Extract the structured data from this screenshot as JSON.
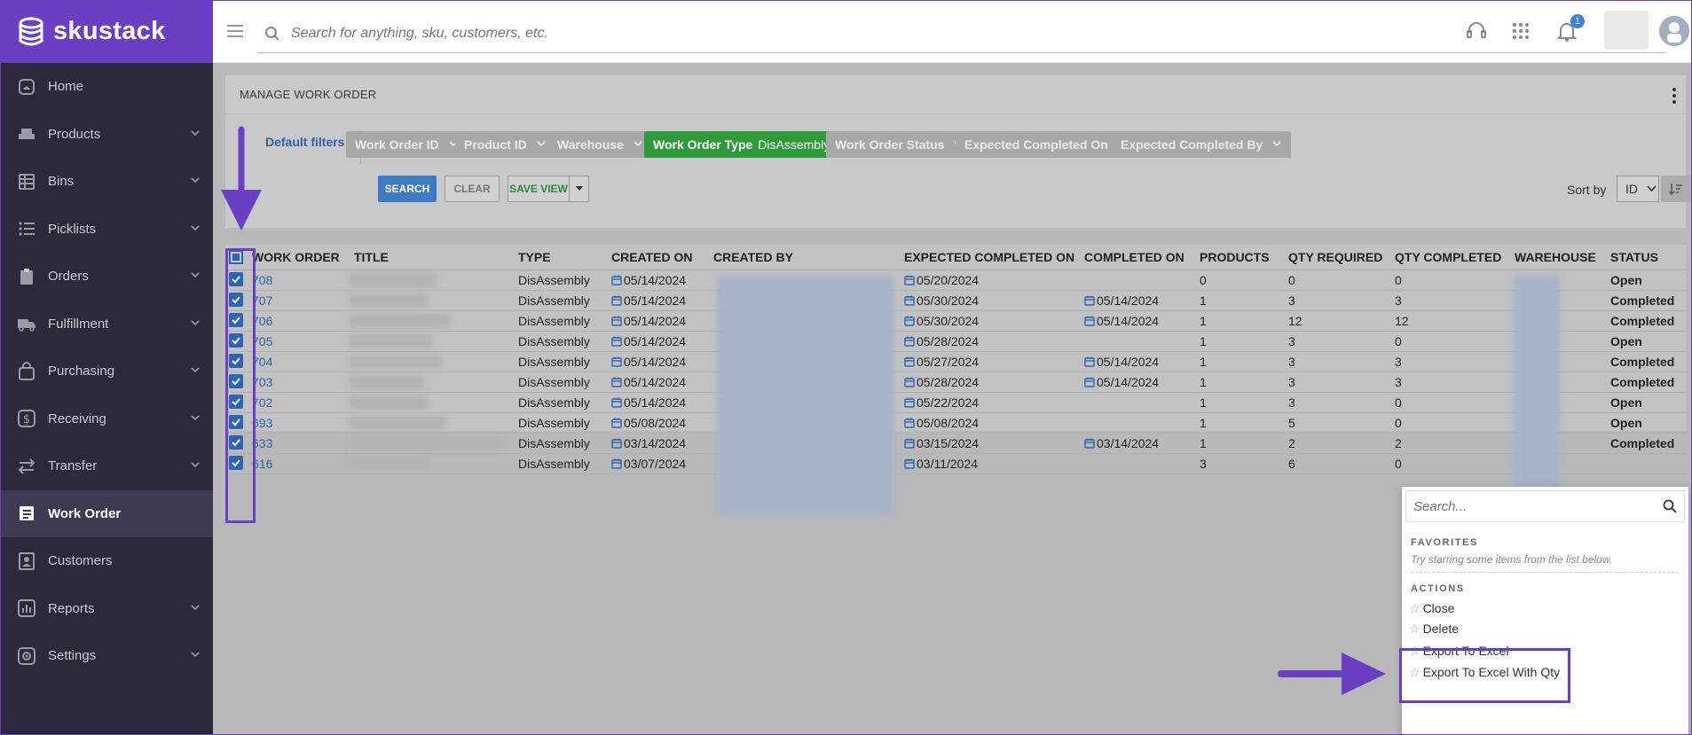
{
  "brand": {
    "name": "skustack"
  },
  "search": {
    "placeholder": "Search for anything, sku, customers, etc."
  },
  "header": {
    "notification_count": "1"
  },
  "sidebar": {
    "items": [
      {
        "label": "Home",
        "icon": "home-icon",
        "chevron": false
      },
      {
        "label": "Products",
        "icon": "products-icon",
        "chevron": true
      },
      {
        "label": "Bins",
        "icon": "bins-icon",
        "chevron": true
      },
      {
        "label": "Picklists",
        "icon": "picklists-icon",
        "chevron": true
      },
      {
        "label": "Orders",
        "icon": "orders-icon",
        "chevron": true
      },
      {
        "label": "Fulfillment",
        "icon": "truck-icon",
        "chevron": true
      },
      {
        "label": "Purchasing",
        "icon": "bag-icon",
        "chevron": true
      },
      {
        "label": "Receiving",
        "icon": "dollar-icon",
        "chevron": true
      },
      {
        "label": "Transfer",
        "icon": "transfer-icon",
        "chevron": true
      },
      {
        "label": "Work Order",
        "icon": "work-order-icon",
        "chevron": false,
        "active": true
      },
      {
        "label": "Customers",
        "icon": "customers-icon",
        "chevron": false
      },
      {
        "label": "Reports",
        "icon": "reports-icon",
        "chevron": true
      },
      {
        "label": "Settings",
        "icon": "gear-icon",
        "chevron": true
      }
    ]
  },
  "page": {
    "title": "MANAGE WORK ORDER",
    "default_filters": "Default filters",
    "filters": [
      {
        "label": "Work Order ID",
        "value": ""
      },
      {
        "label": "Product ID",
        "value": ""
      },
      {
        "label": "Warehouse",
        "value": ""
      },
      {
        "label": "Work Order Type",
        "value": "DisAssembly",
        "active": true
      },
      {
        "label": "Work Order Status",
        "value": ""
      },
      {
        "label": "Expected Completed On",
        "value": ""
      },
      {
        "label": "Expected Completed By",
        "value": ""
      }
    ],
    "buttons": {
      "search": "SEARCH",
      "clear": "CLEAR",
      "save_view": "SAVE VIEW"
    },
    "sort": {
      "label": "Sort by",
      "value": "ID"
    }
  },
  "table": {
    "columns": [
      "WORK ORDER",
      "TITLE",
      "TYPE",
      "CREATED ON",
      "CREATED BY",
      "EXPECTED COMPLETED ON",
      "COMPLETED ON",
      "PRODUCTS",
      "QTY REQUIRED",
      "QTY COMPLETED",
      "WAREHOUSE",
      "STATUS"
    ],
    "rows": [
      {
        "id": "708",
        "type": "DisAssembly",
        "created_on": "05/14/2024",
        "expected": "05/20/2024",
        "completed": "",
        "products": "0",
        "qty_required": "0",
        "qty_completed": "0",
        "status": "Open"
      },
      {
        "id": "707",
        "type": "DisAssembly",
        "created_on": "05/14/2024",
        "expected": "05/30/2024",
        "completed": "05/14/2024",
        "products": "1",
        "qty_required": "3",
        "qty_completed": "3",
        "status": "Completed"
      },
      {
        "id": "706",
        "type": "DisAssembly",
        "created_on": "05/14/2024",
        "expected": "05/30/2024",
        "completed": "05/14/2024",
        "products": "1",
        "qty_required": "12",
        "qty_completed": "12",
        "status": "Completed"
      },
      {
        "id": "705",
        "type": "DisAssembly",
        "created_on": "05/14/2024",
        "expected": "05/28/2024",
        "completed": "",
        "products": "1",
        "qty_required": "3",
        "qty_completed": "0",
        "status": "Open"
      },
      {
        "id": "704",
        "type": "DisAssembly",
        "created_on": "05/14/2024",
        "expected": "05/27/2024",
        "completed": "05/14/2024",
        "products": "1",
        "qty_required": "3",
        "qty_completed": "3",
        "status": "Completed"
      },
      {
        "id": "703",
        "type": "DisAssembly",
        "created_on": "05/14/2024",
        "expected": "05/28/2024",
        "completed": "05/14/2024",
        "products": "1",
        "qty_required": "3",
        "qty_completed": "3",
        "status": "Completed"
      },
      {
        "id": "702",
        "type": "DisAssembly",
        "created_on": "05/14/2024",
        "expected": "05/22/2024",
        "completed": "",
        "products": "1",
        "qty_required": "3",
        "qty_completed": "0",
        "status": "Open"
      },
      {
        "id": "693",
        "type": "DisAssembly",
        "created_on": "05/08/2024",
        "expected": "05/08/2024",
        "completed": "",
        "products": "1",
        "qty_required": "5",
        "qty_completed": "0",
        "status": "Open"
      },
      {
        "id": "633",
        "type": "DisAssembly",
        "created_on": "03/14/2024",
        "expected": "03/15/2024",
        "completed": "03/14/2024",
        "products": "1",
        "qty_required": "2",
        "qty_completed": "2",
        "status": "Completed"
      },
      {
        "id": "616",
        "type": "DisAssembly",
        "created_on": "03/07/2024",
        "expected": "03/11/2024",
        "completed": "",
        "products": "3",
        "qty_required": "6",
        "qty_completed": "0",
        "status": ""
      }
    ]
  },
  "menu": {
    "search_placeholder": "Search...",
    "favorites_heading": "FAVORITES",
    "favorites_hint": "Try starring some items from the list below.",
    "actions_heading": "ACTIONS",
    "actions": [
      "Close",
      "Delete",
      "Export To Excel",
      "Export To Excel With Qty"
    ]
  },
  "colors": {
    "brand": "#6a3fc3",
    "sidebar": "#2b2a3d",
    "link": "#2e63a8",
    "active_filter": "#2e9a3a",
    "annotation": "#6b3fc4"
  }
}
